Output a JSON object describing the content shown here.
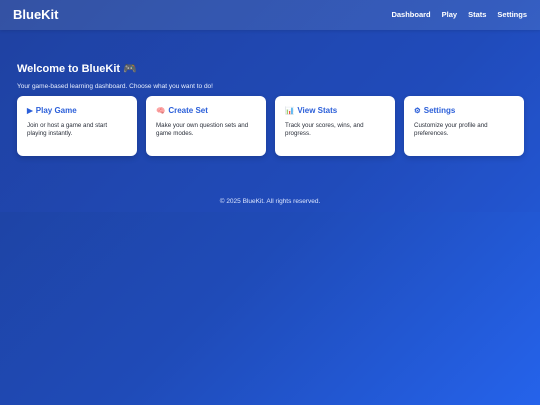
{
  "app": {
    "brand": "BlueKit"
  },
  "nav": {
    "items": [
      {
        "label": "Dashboard"
      },
      {
        "label": "Play"
      },
      {
        "label": "Stats"
      },
      {
        "label": "Settings"
      }
    ]
  },
  "welcome": {
    "title": "Welcome to BlueKit 🎮",
    "subtitle": "Your game-based learning dashboard. Choose what you want to do!"
  },
  "cards": [
    {
      "icon": "▶",
      "icon_name": "play-icon",
      "title": "Play Game",
      "description": "Join or host a game and start playing instantly."
    },
    {
      "icon": "🧠",
      "icon_name": "brain-icon",
      "title": "Create Set",
      "description": "Make your own question sets and game modes."
    },
    {
      "icon": "📊",
      "icon_name": "bar-chart-icon",
      "title": "View Stats",
      "description": "Track your scores, wins, and progress."
    },
    {
      "icon": "⚙",
      "icon_name": "gear-icon",
      "title": "Settings",
      "description": "Customize your profile and preferences."
    }
  ],
  "footer": {
    "text": "© 2025 BlueKit. All rights reserved."
  },
  "colors": {
    "background_start": "#1e3f99",
    "background_end": "#2563eb",
    "card_title": "#2b5fd9",
    "card_background": "#ffffff"
  }
}
